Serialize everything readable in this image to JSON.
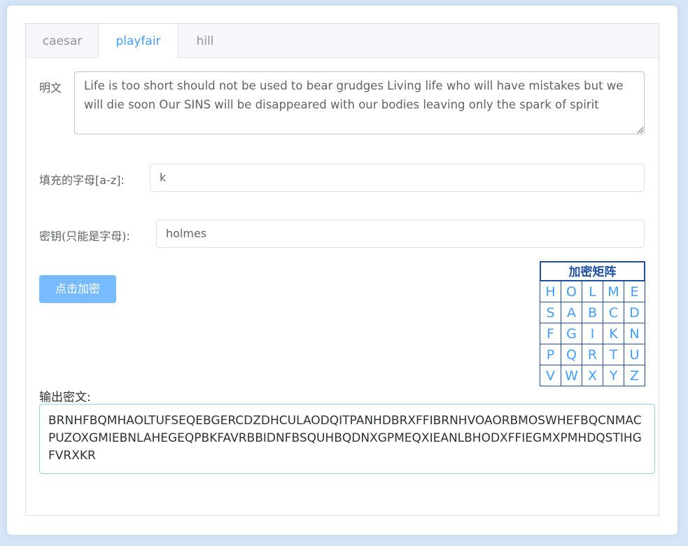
{
  "tabs": [
    {
      "label": "caesar",
      "active": false
    },
    {
      "label": "playfair",
      "active": true
    },
    {
      "label": "hill",
      "active": false
    }
  ],
  "form": {
    "plaintext_label": "明文",
    "plaintext_value": "Life is too short should not be used to bear grudges  Living life  who will have mistakes  but we will die soon  Our SINS will be disappeared with our bodies leaving only the spark of spirit",
    "fill_label": "填充的字母[a-z]:",
    "fill_value": "k",
    "key_label": "密钥(只能是字母):",
    "key_value": "holmes",
    "encrypt_button": "点击加密"
  },
  "matrix": {
    "title": "加密矩阵",
    "rows": [
      [
        "H",
        "O",
        "L",
        "M",
        "E"
      ],
      [
        "S",
        "A",
        "B",
        "C",
        "D"
      ],
      [
        "F",
        "G",
        "I",
        "K",
        "N"
      ],
      [
        "P",
        "Q",
        "R",
        "T",
        "U"
      ],
      [
        "V",
        "W",
        "X",
        "Y",
        "Z"
      ]
    ]
  },
  "output": {
    "label": "输出密文:",
    "ciphertext": "BRNHFBQMHAOLTUFSEQEBGERCDZDHCULAODQITPANHDBRXFFIBRNHVOAORBMOSWHEFBQCNMACPUZOXGMIEBNLAHEGEQPBKFAVRBBIDNFBSQUHBQDNXGPMEQXIEANLBHODXFFIEGMXPMHDQSTIHGFVRXKR"
  },
  "colors": {
    "accent": "#409eff",
    "button_bg": "#79bbff",
    "matrix_border": "#1f4fa0",
    "page_bg": "#d6e6f7"
  }
}
